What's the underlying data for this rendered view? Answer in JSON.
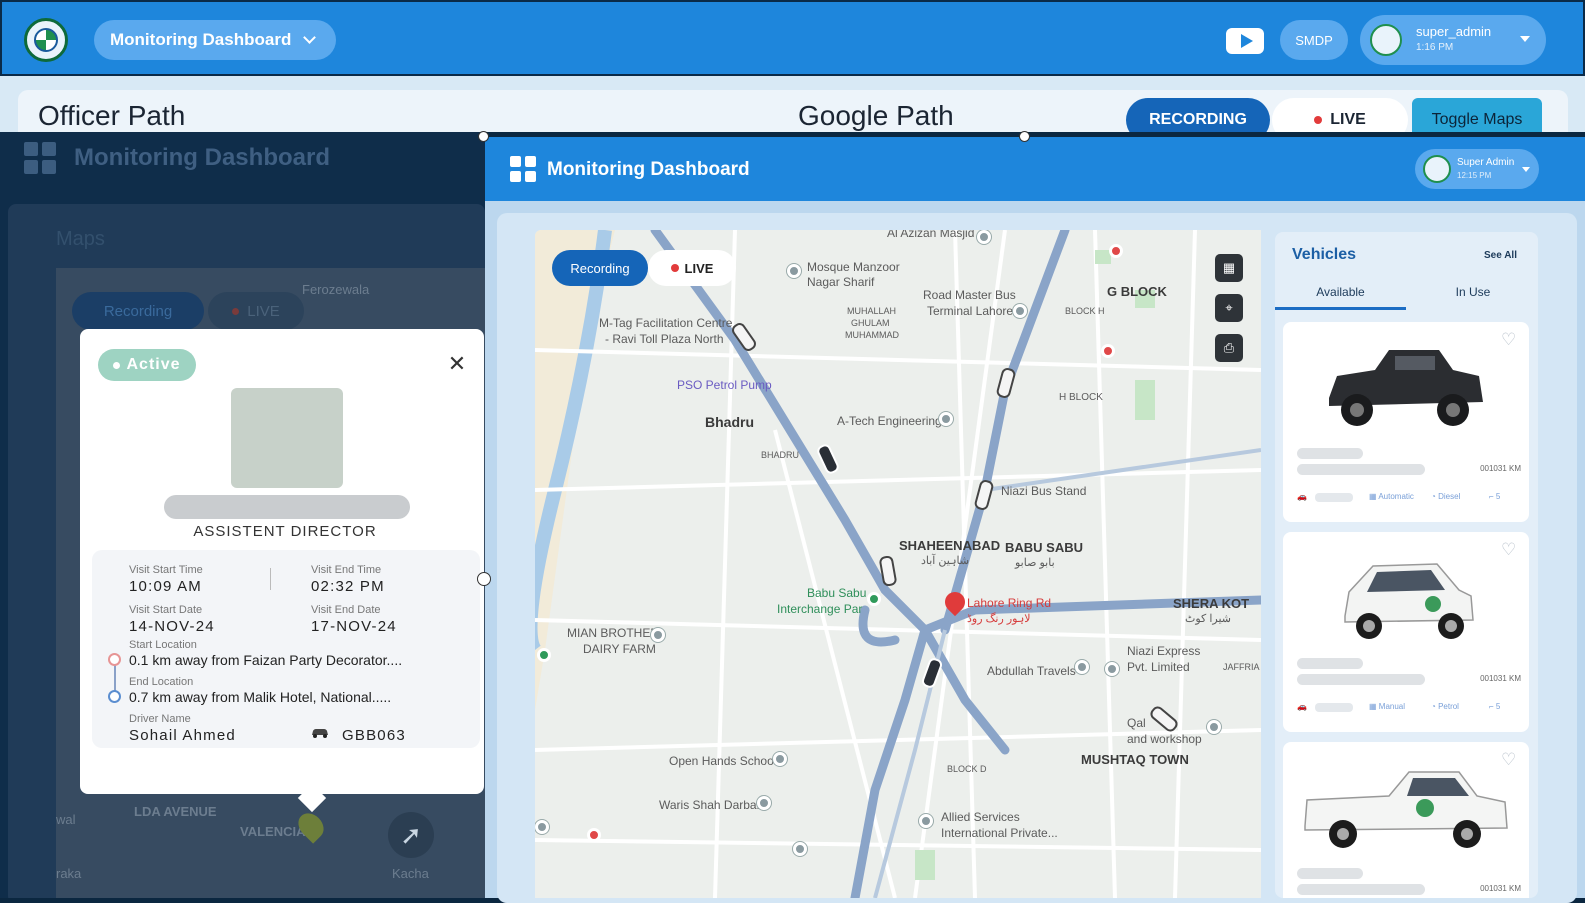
{
  "topbar": {
    "dashboard_select": "Monitoring Dashboard",
    "smdp_label": "SMDP",
    "user": {
      "name": "super_admin",
      "time": "1:16 PM"
    }
  },
  "header": {
    "officer_path": "Officer Path",
    "google_path": "Google Path",
    "recording_tab": "RECORDING",
    "live_tab": "LIVE",
    "toggle_maps": "Toggle Maps"
  },
  "left_panel": {
    "title": "Monitoring Dashboard",
    "maps_label": "Maps",
    "recording": "Recording",
    "live": "LIVE",
    "map_labels": [
      "Ferozewala",
      "LDA AVENUE",
      "VALENCIA",
      "Kacha",
      "wal",
      "raka"
    ]
  },
  "popup": {
    "status": "Active",
    "designation": "ASSISTENT DIRECTOR",
    "visit_start_time_label": "Visit Start Time",
    "visit_start_time": "10:09 AM",
    "visit_end_time_label": "Visit End Time",
    "visit_end_time": "02:32 PM",
    "visit_start_date_label": "Visit Start Date",
    "visit_start_date": "14-NOV-24",
    "visit_end_date_label": "Visit End Date",
    "visit_end_date": "17-NOV-24",
    "start_location_label": "Start Location",
    "start_location": "0.1 km away from Faizan Party Decorator....",
    "end_location_label": "End Location",
    "end_location": "0.7 km away from Malik Hotel, National.....",
    "driver_name_label": "Driver Name",
    "driver_name": "Sohail Ahmed",
    "vehicle_number": "GBB063"
  },
  "right_panel": {
    "title": "Monitoring Dashboard",
    "user": {
      "name": "Super Admin",
      "time": "12:15 PM"
    },
    "map": {
      "recording": "Recording",
      "live": "LIVE",
      "labels": {
        "al_azizan": "Al Azizan Masjid",
        "mosque": "Mosque Manzoor",
        "mosque2": "Nagar Sharif",
        "mtag": "M-Tag Facilitation Centre",
        "mtag2": "- Ravi Toll Plaza North",
        "pso": "PSO Petrol Pump",
        "bhadru": "Bhadru",
        "bhadru_small": "BHADRU",
        "atech": "A-Tech Engineering",
        "muhallah": "MUHALLAH",
        "ghulam": "GHULAM",
        "muhammad": "MUHAMMAD",
        "roadmaster": "Road Master Bus",
        "roadmaster2": "Terminal Lahore",
        "gblock": "G BLOCK",
        "blockh": "BLOCK H",
        "hblock": "H BLOCK",
        "niazi_stand": "Niazi Bus Stand",
        "shaheenabad": "SHAHEENABAD",
        "shaheen_ur": "شاہین آباد",
        "babusabu": "BABU SABU",
        "babusabu_ur": "بابو صابو",
        "babusabu_ic": "Babu Sabu",
        "babusabu_ic2": "Interchange Par",
        "ringrd": "Lahore Ring Rd",
        "ringrd_ur": "لاہور رنگ روڈ",
        "miandairy": "MIAN BROTHER",
        "miandairy2": "DAIRY FARM",
        "sherakot": "SHERA KOT",
        "sherakot_ur": "شیرا کوٹ",
        "niazi_express": "Niazi Express",
        "niazi_express2": "Pvt. Limited",
        "abdullah": "Abdullah Travels",
        "jaffria": "JAFFRIA",
        "qalandar": "Qal",
        "workshop": "and workshop",
        "mushtaq": "MUSHTAQ TOWN",
        "blockd": "BLOCK D",
        "openhands": "Open Hands School",
        "warisshah": "Waris Shah Darbar",
        "allied": "Allied Services",
        "allied2": "International Private..."
      }
    },
    "vehicles": {
      "title": "Vehicles",
      "see_all": "See All",
      "tabs": [
        "Available",
        "In Use"
      ],
      "cards": [
        {
          "km": "001031 KM",
          "specs": [
            "Automatic",
            "Diesel",
            "5"
          ]
        },
        {
          "km": "001031 KM",
          "specs": [
            "Manual",
            "Petrol",
            "5"
          ]
        },
        {
          "km": "001031 KM",
          "specs": []
        }
      ]
    }
  },
  "colors": {
    "primary": "#1e86dc",
    "dark_panel": "#0f2d4a",
    "active": "#9ed3c2",
    "accent": "#1565b8"
  }
}
